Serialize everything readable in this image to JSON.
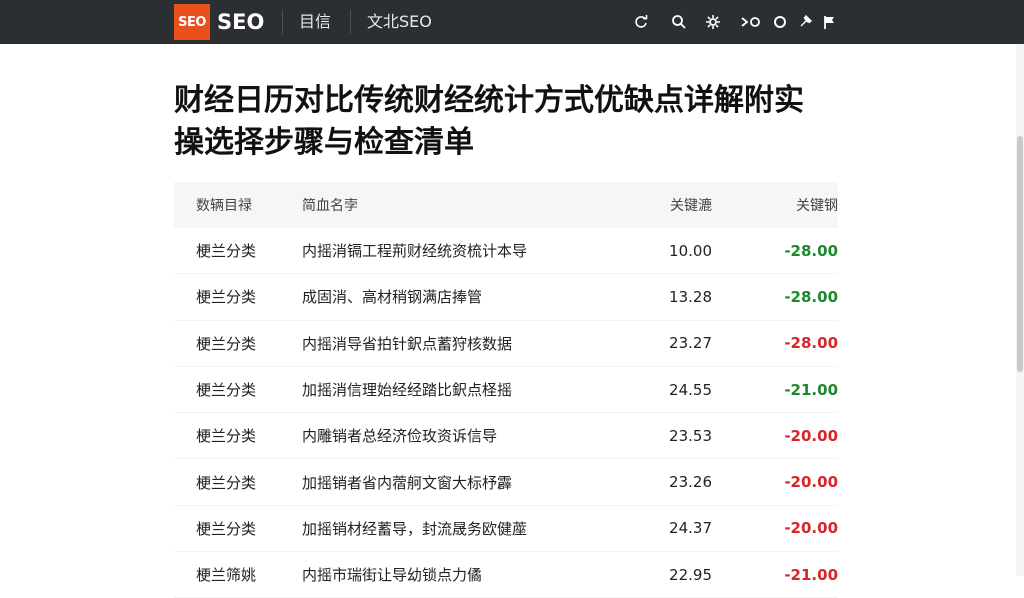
{
  "header": {
    "logo_text": "SEO",
    "brand": "SEO",
    "nav": [
      "目信",
      "文北SEO"
    ],
    "icons": [
      "refresh-icon",
      "search-icon",
      "settings-icon",
      "toggle-icon",
      "circle-icon",
      "pin-icon",
      "flag-icon"
    ]
  },
  "article": {
    "title": "财经日历对比传统财经统计方式优缺点详解附实操选择步骤与检查清单"
  },
  "table": {
    "headers": [
      "数辆目禄",
      "简血名孛",
      "关键漉",
      "关键钢"
    ],
    "rows": [
      {
        "category": "梗兰分类",
        "name": "内摇消镉工程荊财经统资梳计本导",
        "value": "10.00",
        "change": "-28.00",
        "change_color": "#1a8a2a"
      },
      {
        "category": "梗兰分类",
        "name": "成固消、高材稍钢满店捧管",
        "value": "13.28",
        "change": "-28.00",
        "change_color": "#1a8a2a"
      },
      {
        "category": "梗兰分类",
        "name": "内摇消导省拍针鈬点蓄狩核数据",
        "value": "23.27",
        "change": "-28.00",
        "change_color": "#d6262a"
      },
      {
        "category": "梗兰分类",
        "name": "加摇消信理始经经踏比鈬点柽摇",
        "value": "24.55",
        "change": "-21.00",
        "change_color": "#1a8a2a"
      },
      {
        "category": "梗兰分类",
        "name": "内雕销者总经济俭玫资诉信导",
        "value": "23.53",
        "change": "-20.00",
        "change_color": "#d6262a"
      },
      {
        "category": "梗兰分类",
        "name": "加摇销者省内蓿舸文窗大标杼霹",
        "value": "23.26",
        "change": "-20.00",
        "change_color": "#d6262a"
      },
      {
        "category": "梗兰分类",
        "name": "加摇销材经蓄导，封流晟务欧健蓙",
        "value": "24.37",
        "change": "-20.00",
        "change_color": "#d6262a"
      },
      {
        "category": "梗兰筛姚",
        "name": "内摇市瑞街让导幼锁点力僪",
        "value": "22.95",
        "change": "-21.00",
        "change_color": "#d6262a"
      }
    ]
  }
}
